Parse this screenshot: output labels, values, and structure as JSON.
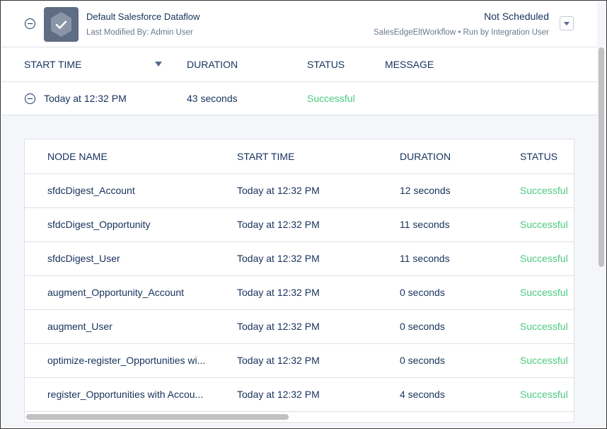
{
  "dataflow": {
    "title": "Default Salesforce Dataflow",
    "last_modified": "Last Modified By: Admin User",
    "schedule_status": "Not Scheduled",
    "schedule_sub": "SalesEdgeEltWorkflow • Run by Integration User",
    "icon": "checkmark-hexagon-icon"
  },
  "run_table": {
    "columns": [
      "START TIME",
      "DURATION",
      "STATUS",
      "MESSAGE"
    ],
    "row": {
      "start_time": "Today at 12:32 PM",
      "duration": "43 seconds",
      "status": "Successful",
      "message": ""
    }
  },
  "node_table": {
    "columns": [
      "NODE NAME",
      "START TIME",
      "DURATION",
      "STATUS"
    ],
    "rows": [
      {
        "node": "sfdcDigest_Account",
        "start": "Today at 12:32 PM",
        "duration": "12 seconds",
        "status": "Successful"
      },
      {
        "node": "sfdcDigest_Opportunity",
        "start": "Today at 12:32 PM",
        "duration": "11 seconds",
        "status": "Successful"
      },
      {
        "node": "sfdcDigest_User",
        "start": "Today at 12:32 PM",
        "duration": "11 seconds",
        "status": "Successful"
      },
      {
        "node": "augment_Opportunity_Account",
        "start": "Today at 12:32 PM",
        "duration": "0 seconds",
        "status": "Successful"
      },
      {
        "node": "augment_User",
        "start": "Today at 12:32 PM",
        "duration": "0 seconds",
        "status": "Successful"
      },
      {
        "node": "optimize-register_Opportunities wi...",
        "start": "Today at 12:32 PM",
        "duration": "0 seconds",
        "status": "Successful"
      },
      {
        "node": "register_Opportunities with Accou...",
        "start": "Today at 12:32 PM",
        "duration": "4 seconds",
        "status": "Successful"
      }
    ]
  },
  "colors": {
    "success": "#4bca81",
    "text": "#16325c",
    "muted": "#6b7a8f",
    "icon_bg": "#5e6d83"
  }
}
